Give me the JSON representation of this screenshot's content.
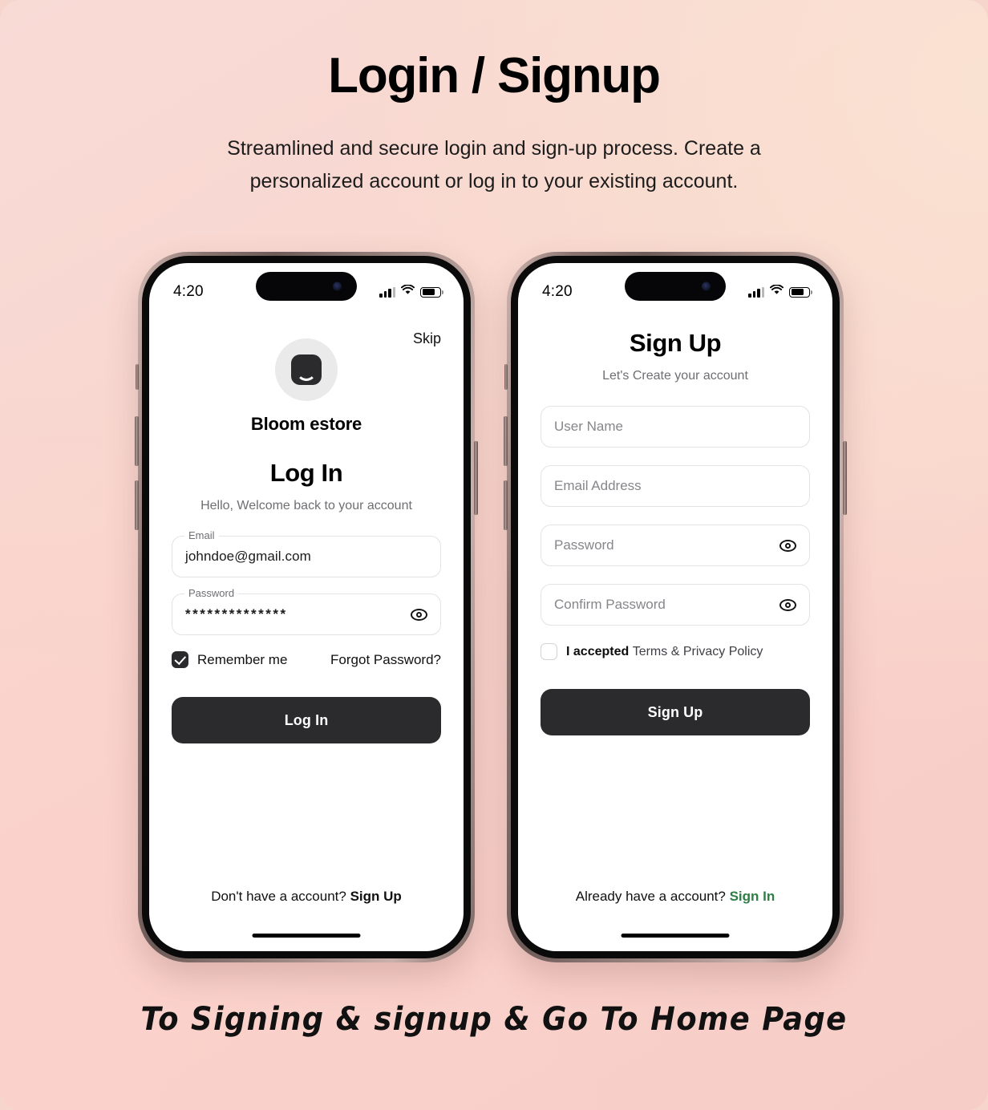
{
  "header": {
    "title": "Login / Signup",
    "subtitle": "Streamlined and secure login and sign-up process. Create a personalized account or log in to your existing account."
  },
  "footer": {
    "caption": "To Signing & signup & Go To Home Page"
  },
  "colors": {
    "accent_green": "#2e7d45",
    "button_dark": "#2b2b2e",
    "background_pink": "#f9cfc9",
    "background_peach": "#fae2d2"
  },
  "status_bar": {
    "time": "4:20",
    "signal_icon": "cellular-signal-icon",
    "wifi_icon": "wifi-icon",
    "battery_icon": "battery-icon"
  },
  "login_screen": {
    "skip_label": "Skip",
    "brand_name": "Bloom estore",
    "brand_logo_icon": "shopping-bag-icon",
    "title": "Log In",
    "subtitle": "Hello, Welcome back to your account",
    "email_field": {
      "legend": "Email",
      "value": "johndoe@gmail.com"
    },
    "password_field": {
      "legend": "Password",
      "value": "**************",
      "toggle_icon": "eye-icon"
    },
    "remember_me_label": "Remember me",
    "remember_me_checked": true,
    "forgot_password_label": "Forgot Password?",
    "submit_label": "Log In",
    "switch_prompt": "Don't have a account? ",
    "switch_action": "Sign Up"
  },
  "signup_screen": {
    "title": "Sign Up",
    "subtitle": "Let's Create your account",
    "username_placeholder": "User Name",
    "email_placeholder": "Email Address",
    "password_placeholder": "Password",
    "confirm_password_placeholder": "Confirm Password",
    "password_toggle_icon": "eye-icon",
    "terms_checked": false,
    "terms_prefix": "I accepted ",
    "terms_rest": "Terms & Privacy Policy",
    "submit_label": "Sign Up",
    "switch_prompt": "Already have a account? ",
    "switch_action": "Sign In"
  }
}
